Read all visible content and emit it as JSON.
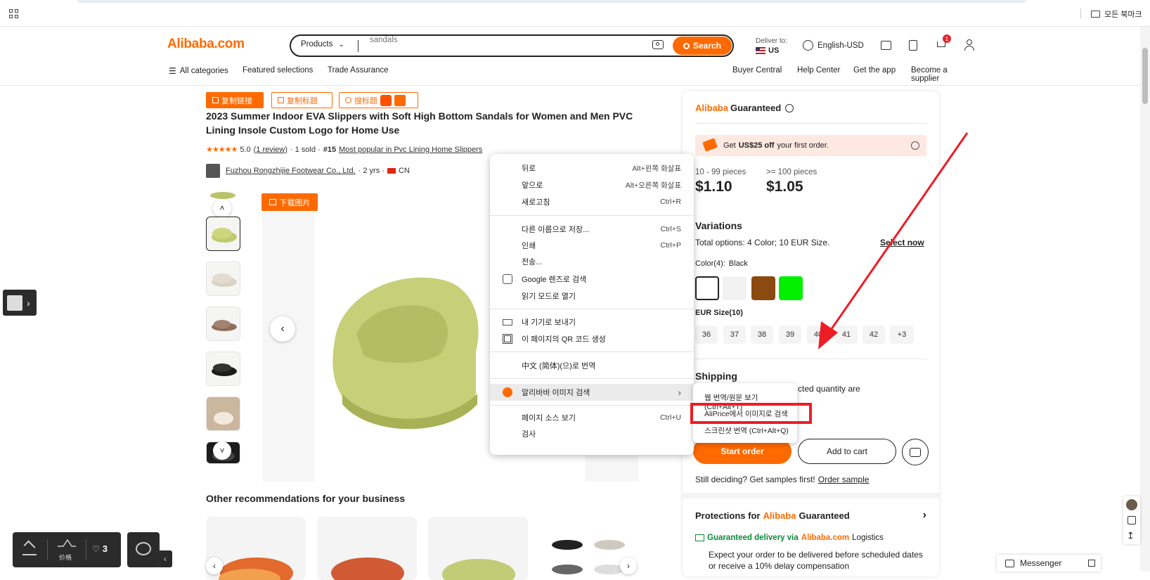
{
  "browser": {
    "bookmarks_label": "모든 북마크"
  },
  "header": {
    "logo": "Alibaba.com",
    "search_category": "Products",
    "search_value": "sandals",
    "search_button": "Search",
    "deliver_label": "Deliver to:",
    "deliver_country": "US",
    "language": "English-USD",
    "cart_count": "1"
  },
  "nav": {
    "all_categories": "All categories",
    "featured": "Featured selections",
    "trade_assurance": "Trade Assurance",
    "buyer_central": "Buyer Central",
    "help_center": "Help Center",
    "get_app": "Get the app",
    "become_supplier": "Become a supplier"
  },
  "ext_toolbar": {
    "copy_link": "复制链接",
    "copy_title": "复制标题",
    "search_title": "搜标题",
    "download_image": "下载图片"
  },
  "product": {
    "title": "2023 Summer Indoor EVA Slippers with Soft High Bottom Sandals for Women and Men PVC Lining Insole Custom Logo for Home Use",
    "rating": "5.0",
    "reviews": "(1 review)",
    "sold": "· 1 sold ·",
    "rank": "#15",
    "rank_text": "Most popular in Pvc Lining Home Slippers",
    "supplier": "Fuzhou Rongzhijie Footwear Co., Ltd.",
    "years": "· 2 yrs ·",
    "country": "CN"
  },
  "recommendations": {
    "heading": "Other recommendations for your business"
  },
  "panel": {
    "brand1": "Alibaba",
    "brand2": "Guaranteed",
    "coupon_pre": "Get",
    "coupon_amt": "US$25 off",
    "coupon_post": "your first order.",
    "tier1_label": "10 - 99 pieces",
    "tier1_price": "$1.10",
    "tier2_label": ">= 100 pieces",
    "tier2_price": "$1.05",
    "variations": "Variations",
    "total_options": "Total options: 4 Color; 10 EUR Size.",
    "select_now": "Select now",
    "color_label": "Color(4):",
    "color_value": "Black",
    "swatches": [
      "#000000",
      "#f2f2f2",
      "#8b4a10",
      "#00f000"
    ],
    "size_label": "EUR Size(10)",
    "sizes": [
      "36",
      "37",
      "38",
      "39",
      "40",
      "41",
      "42",
      "+3"
    ],
    "shipping": "Shipping",
    "shipping_text": "cted quantity are",
    "start_order": "Start order",
    "add_to_cart": "Add to cart",
    "samples_text": "Still deciding? Get samples first!",
    "order_sample": "Order sample",
    "protections": "Protections for",
    "guaranteed_delivery": "Guaranteed delivery via",
    "logistics": "Logistics",
    "delivery_text": "Expect your order to be delivered before scheduled dates or receive a 10% delay compensation"
  },
  "context_menu": {
    "back": "뒤로",
    "back_sc": "Alt+왼쪽 화살표",
    "forward": "앞으로",
    "forward_sc": "Alt+오른쪽 화살표",
    "reload": "새로고침",
    "reload_sc": "Ctrl+R",
    "save_as": "다른 이름으로 저장...",
    "save_as_sc": "Ctrl+S",
    "print": "인쇄",
    "print_sc": "Ctrl+P",
    "cast": "전송...",
    "google_lens": "Google 렌즈로 검색",
    "reading_mode": "읽기 모드로 열기",
    "send_to_devices": "내 기기로 보내기",
    "qr_code": "이 페이지의 QR 코드 생성",
    "translate": "中文 (简体)(으)로 번역",
    "alibaba_image_search": "알리바바 이미지 검색",
    "view_source": "페이지 소스 보기",
    "view_source_sc": "Ctrl+U",
    "inspect": "검사"
  },
  "submenu": {
    "item1": "웹 번역/원문 보기 (Ctrl+Alt+T)",
    "item2": "AliPrice에서 이미지로 검색",
    "item3": "스크린샷 번역 (Ctrl+Alt+Q)"
  },
  "dock": {
    "price_label": "价格",
    "likes": "3"
  },
  "messenger": {
    "label": "Messenger"
  }
}
